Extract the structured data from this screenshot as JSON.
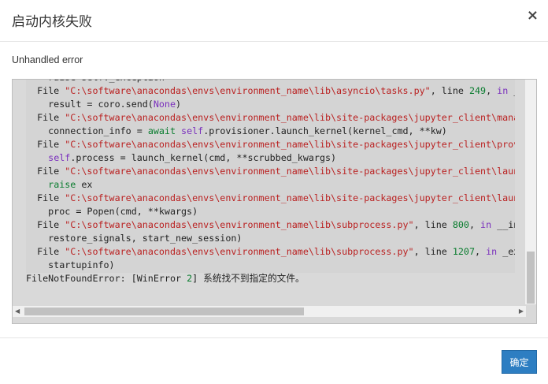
{
  "dialog": {
    "title": "启动内核失败",
    "close_label": "×",
    "subtitle": "Unhandled error",
    "ok_label": "确定"
  },
  "traceback": [
    [
      {
        "t": "    raise self._exception",
        "c": "c"
      }
    ],
    [
      {
        "t": "  File ",
        "c": "c"
      },
      {
        "t": "\"C:\\software\\anacondas\\envs\\environment_name\\lib\\asyncio\\tasks.py\"",
        "c": "s"
      },
      {
        "t": ", line ",
        "c": "c"
      },
      {
        "t": "249",
        "c": "n"
      },
      {
        "t": ", ",
        "c": "c"
      },
      {
        "t": "in",
        "c": "k"
      },
      {
        "t": " __step",
        "c": "c"
      }
    ],
    [
      {
        "t": "    result = coro.send(",
        "c": "c"
      },
      {
        "t": "None",
        "c": "k"
      },
      {
        "t": ")",
        "c": "c"
      }
    ],
    [
      {
        "t": "  File ",
        "c": "c"
      },
      {
        "t": "\"C:\\software\\anacondas\\envs\\environment_name\\lib\\site-packages\\jupyter_client\\manager.py\"",
        "c": "s"
      }
    ],
    [
      {
        "t": "    connection_info = ",
        "c": "c"
      },
      {
        "t": "await",
        "c": "n"
      },
      {
        "t": " ",
        "c": "c"
      },
      {
        "t": "self",
        "c": "k"
      },
      {
        "t": ".provisioner.launch_kernel(kernel_cmd, **kw)",
        "c": "c"
      }
    ],
    [
      {
        "t": "  File ",
        "c": "c"
      },
      {
        "t": "\"C:\\software\\anacondas\\envs\\environment_name\\lib\\site-packages\\jupyter_client\\provisioning\"",
        "c": "s"
      }
    ],
    [
      {
        "t": "    ",
        "c": "c"
      },
      {
        "t": "self",
        "c": "k"
      },
      {
        "t": ".process = launch_kernel(cmd, **scrubbed_kwargs)",
        "c": "c"
      }
    ],
    [
      {
        "t": "  File ",
        "c": "c"
      },
      {
        "t": "\"C:\\software\\anacondas\\envs\\environment_name\\lib\\site-packages\\jupyter_client\\launcher.py\"",
        "c": "s"
      }
    ],
    [
      {
        "t": "    ",
        "c": "c"
      },
      {
        "t": "raise",
        "c": "n"
      },
      {
        "t": " ex",
        "c": "c"
      }
    ],
    [
      {
        "t": "  File ",
        "c": "c"
      },
      {
        "t": "\"C:\\software\\anacondas\\envs\\environment_name\\lib\\site-packages\\jupyter_client\\launcher.py\"",
        "c": "s"
      }
    ],
    [
      {
        "t": "    proc = Popen(cmd, **kwargs)",
        "c": "c"
      }
    ],
    [
      {
        "t": "  File ",
        "c": "c"
      },
      {
        "t": "\"C:\\software\\anacondas\\envs\\environment_name\\lib\\subprocess.py\"",
        "c": "s"
      },
      {
        "t": ", line ",
        "c": "c"
      },
      {
        "t": "800",
        "c": "n"
      },
      {
        "t": ", ",
        "c": "c"
      },
      {
        "t": "in",
        "c": "k"
      },
      {
        "t": " __init__",
        "c": "c"
      }
    ],
    [
      {
        "t": "    restore_signals, start_new_session)",
        "c": "c"
      }
    ],
    [
      {
        "t": "  File ",
        "c": "c"
      },
      {
        "t": "\"C:\\software\\anacondas\\envs\\environment_name\\lib\\subprocess.py\"",
        "c": "s"
      },
      {
        "t": ", line ",
        "c": "c"
      },
      {
        "t": "1207",
        "c": "n"
      },
      {
        "t": ", ",
        "c": "c"
      },
      {
        "t": "in",
        "c": "k"
      },
      {
        "t": " _execute_child",
        "c": "c"
      }
    ],
    [
      {
        "t": "    startupinfo)",
        "c": "c"
      }
    ],
    [
      {
        "t": "FileNotFoundError: [WinError ",
        "c": "c"
      },
      {
        "t": "2",
        "c": "n"
      },
      {
        "t": "] 系统找不到指定的文件。",
        "c": "c"
      }
    ]
  ],
  "colors": {
    "primary_button": "#2d7ec2",
    "string": "#ba2121",
    "keyword": "#7a2fbd",
    "number": "#097c2e"
  }
}
